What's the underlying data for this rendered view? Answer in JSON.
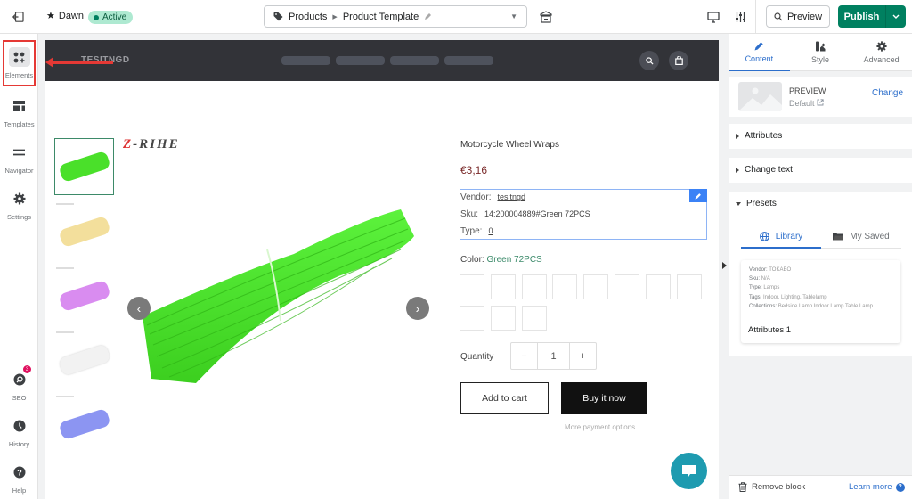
{
  "topbar": {
    "theme_name": "Dawn",
    "status_badge": "Active",
    "template_breadcrumb": [
      "Products",
      "Product Template"
    ],
    "preview_label": "Preview",
    "publish_label": "Publish",
    "icons": {
      "back": "exit-icon",
      "theme": "star-icon",
      "template": "tag-icon",
      "edit": "pencil-icon",
      "store": "store-icon",
      "device": "desktop-icon",
      "settings": "sliders-icon",
      "search": "search-icon"
    }
  },
  "leftbar": {
    "items": [
      {
        "label": "Elements",
        "icon": "elements-grid-icon",
        "active": true
      },
      {
        "label": "Templates",
        "icon": "template-layout-icon"
      },
      {
        "label": "Navigator",
        "icon": "navigator-lines-icon"
      },
      {
        "label": "Settings",
        "icon": "gear-icon"
      },
      {
        "label": "SEO",
        "icon": "seo-search-icon",
        "badge": "3"
      },
      {
        "label": "History",
        "icon": "clock-icon"
      },
      {
        "label": "Help",
        "icon": "question-icon"
      }
    ]
  },
  "store_preview": {
    "logo_text": "TESITNGD",
    "header_icons": [
      "search-icon",
      "bag-icon"
    ],
    "brand_logo": "Z-RIHE",
    "thumbnails": [
      {
        "color": "#4ae02a",
        "label": "Green"
      },
      {
        "color": "#f5e0a0",
        "label": "Yellow"
      },
      {
        "color": "#d98cf0",
        "label": "Purple"
      },
      {
        "color": "#f4f4f4",
        "label": "White"
      },
      {
        "color": "#8c95f2",
        "label": "Blue"
      }
    ],
    "product": {
      "title": "Motorcycle Wheel Wraps",
      "price": "€3,16",
      "price_color": "#7a2a2a",
      "vendor_label": "Vendor:",
      "vendor_value": "tesitngd",
      "sku_label": "Sku:",
      "sku_value": "14:200004889#Green 72PCS",
      "type_label": "Type:",
      "type_value": "0",
      "color_label": "Color:",
      "color_value": "Green 72PCS",
      "swatch_count": 11,
      "quantity_label": "Quantity",
      "quantity_value": "1",
      "minus": "−",
      "plus": "+",
      "add_to_cart": "Add to cart",
      "buy_now": "Buy it now",
      "more_payment": "More payment options"
    }
  },
  "right_panel": {
    "tabs": [
      {
        "label": "Content",
        "icon": "pencil-icon",
        "active": true
      },
      {
        "label": "Style",
        "icon": "style-brush-icon"
      },
      {
        "label": "Advanced",
        "icon": "gear-icon"
      }
    ],
    "preview": {
      "title": "PREVIEW",
      "subtitle": "Default",
      "change_label": "Change"
    },
    "sections": [
      {
        "label": "Attributes",
        "expanded": false
      },
      {
        "label": "Change text",
        "expanded": false
      },
      {
        "label": "Presets",
        "expanded": true
      }
    ],
    "preset_tabs": [
      {
        "label": "Library",
        "icon": "globe-icon",
        "active": true
      },
      {
        "label": "My Saved",
        "icon": "folder-icon"
      }
    ],
    "preset_card": {
      "lines": [
        {
          "label": "Vendor:",
          "value": "TOKABO"
        },
        {
          "label": "Sku:",
          "value": "N/A"
        },
        {
          "label": "Type:",
          "value": "Lamps"
        },
        {
          "label": "Tags:",
          "value": "Indoor, Lighting, Tablelamp"
        },
        {
          "label": "Collections:",
          "value": "Bedside Lamp Indoor Lamp Table Lamp"
        }
      ],
      "name": "Attributes 1"
    },
    "footer": {
      "remove_label": "Remove block",
      "learn_label": "Learn more"
    }
  },
  "colors": {
    "accent": "#2c6ecb",
    "publish": "#008060",
    "highlight": "#e53935",
    "chat": "#1e9bb0"
  }
}
